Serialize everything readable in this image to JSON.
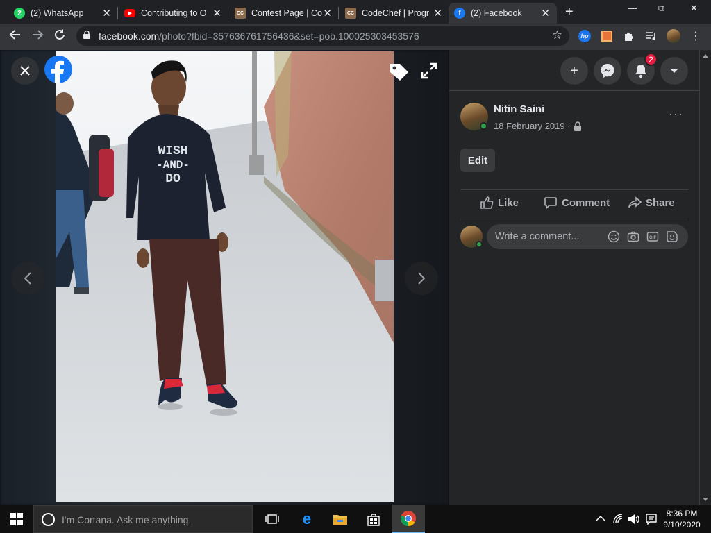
{
  "browser": {
    "tabs": [
      {
        "title": "(2) WhatsApp",
        "favicon": "whatsapp-icon",
        "favicon_text": "2",
        "active": false
      },
      {
        "title": "Contributing to O",
        "favicon": "youtube-icon",
        "favicon_text": "▶",
        "active": false
      },
      {
        "title": "Contest Page | Co",
        "favicon": "codechef-icon",
        "favicon_text": "CC",
        "active": false
      },
      {
        "title": "CodeChef | Progr",
        "favicon": "codechef-icon",
        "favicon_text": "CC",
        "active": false
      },
      {
        "title": "(2) Facebook",
        "favicon": "facebook-icon",
        "favicon_text": "f",
        "active": true
      }
    ],
    "new_tab": "+",
    "window_controls": {
      "minimize": "—",
      "restore": "⧉",
      "close": "✕"
    },
    "url_host": "facebook.com",
    "url_path": "/photo?fbid=357636761756436&set=pob.100025303453576",
    "accent": "#1877f2"
  },
  "viewer": {
    "photo_text_1": "WISH",
    "photo_text_2": "-AND-",
    "photo_text_3": "DO"
  },
  "panel": {
    "top_buttons": {
      "create": "+",
      "notifications_count": "2"
    },
    "author": "Nitin Saini",
    "date": "18 February 2019 ·",
    "edit_label": "Edit",
    "actions": {
      "like": "Like",
      "comment": "Comment",
      "share": "Share"
    },
    "comment_placeholder": "Write a comment...",
    "more": "···"
  },
  "taskbar": {
    "cortana_placeholder": "I'm Cortana. Ask me anything.",
    "time": "8:36 PM",
    "date": "9/10/2020"
  }
}
